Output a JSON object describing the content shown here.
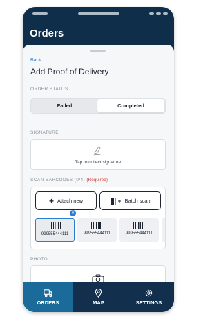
{
  "app": {
    "title": "Orders"
  },
  "sheet": {
    "back_label": "Back",
    "title": "Add Proof of Delivery",
    "order_status": {
      "label": "ORDER STATUS",
      "options": [
        "Failed",
        "Completed"
      ],
      "selected": "Completed"
    },
    "signature": {
      "label": "SIGNATURE",
      "prompt": "Tap to collect signature",
      "icon": "signature-icon"
    },
    "scan": {
      "label": "SCAN BARCODES (0/4)",
      "required_label": "(Required)",
      "attach_label": "Attach new",
      "batch_label": "Batch scan",
      "barcodes": [
        "999555444111",
        "999555444111",
        "999555444111"
      ],
      "selected_index": 0,
      "badge": "×"
    },
    "photo": {
      "label": "PHOTO",
      "icon": "camera-icon"
    }
  },
  "tabs": [
    {
      "label": "ORDERS",
      "icon": "truck-icon",
      "active": true
    },
    {
      "label": "MAP",
      "icon": "map-pin-icon",
      "active": false
    },
    {
      "label": "SETTINGS",
      "icon": "gear-icon",
      "active": false
    }
  ],
  "colors": {
    "accent": "#2b7cd3",
    "required": "#d23a3a",
    "header": "#0f2e4a",
    "tab_active": "#1a6a9a"
  }
}
